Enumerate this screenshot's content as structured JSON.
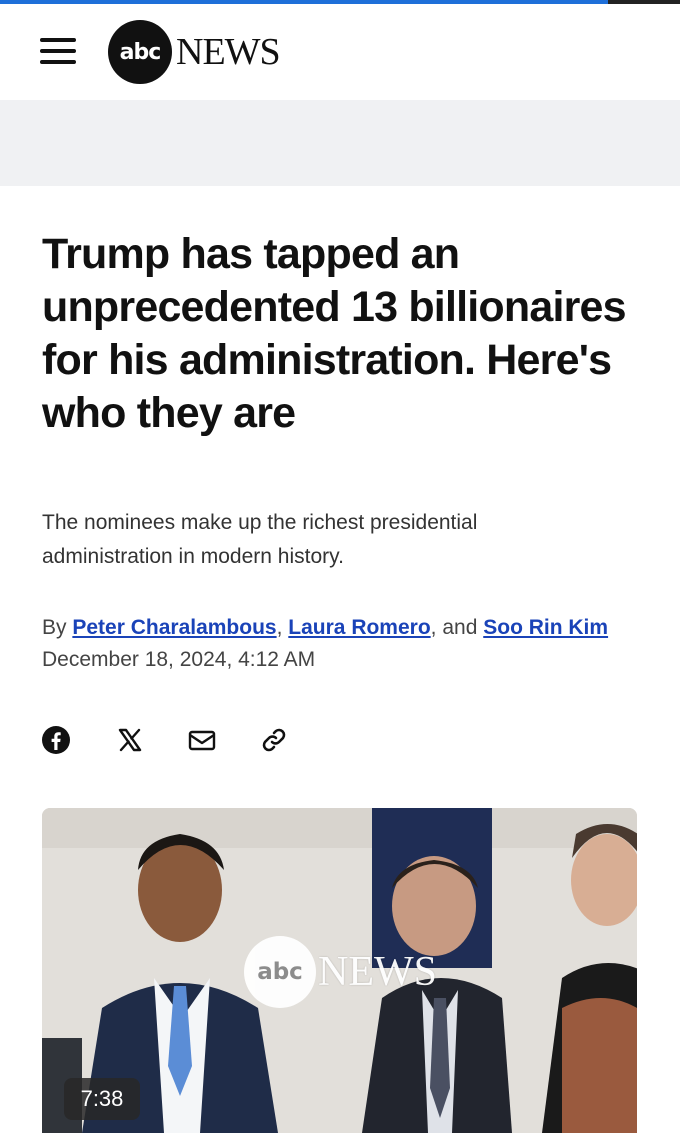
{
  "header": {
    "menu_icon": "hamburger-menu-icon",
    "logo_abc": "abc",
    "logo_news": "NEWS"
  },
  "article": {
    "headline": "Trump has tapped an unprecedented 13 billionaires for his administration. Here's who they are",
    "dek": "The nominees make up the richest presidential administration in modern history.",
    "byline": {
      "prefix": "By",
      "authors": [
        "Peter Charalambous",
        "Laura Romero",
        "Soo Rin Kim"
      ],
      "sep1": ",",
      "sep2": ", and"
    },
    "date": "December 18, 2024, 4:12 AM"
  },
  "share": {
    "icons": [
      "facebook-icon",
      "x-icon",
      "email-icon",
      "link-icon"
    ]
  },
  "media": {
    "duration": "7:38",
    "watermark_abc": "abc",
    "watermark_news": "NEWS"
  },
  "colors": {
    "accent_bar": "#1e6fd9",
    "link": "#1a43b8"
  }
}
